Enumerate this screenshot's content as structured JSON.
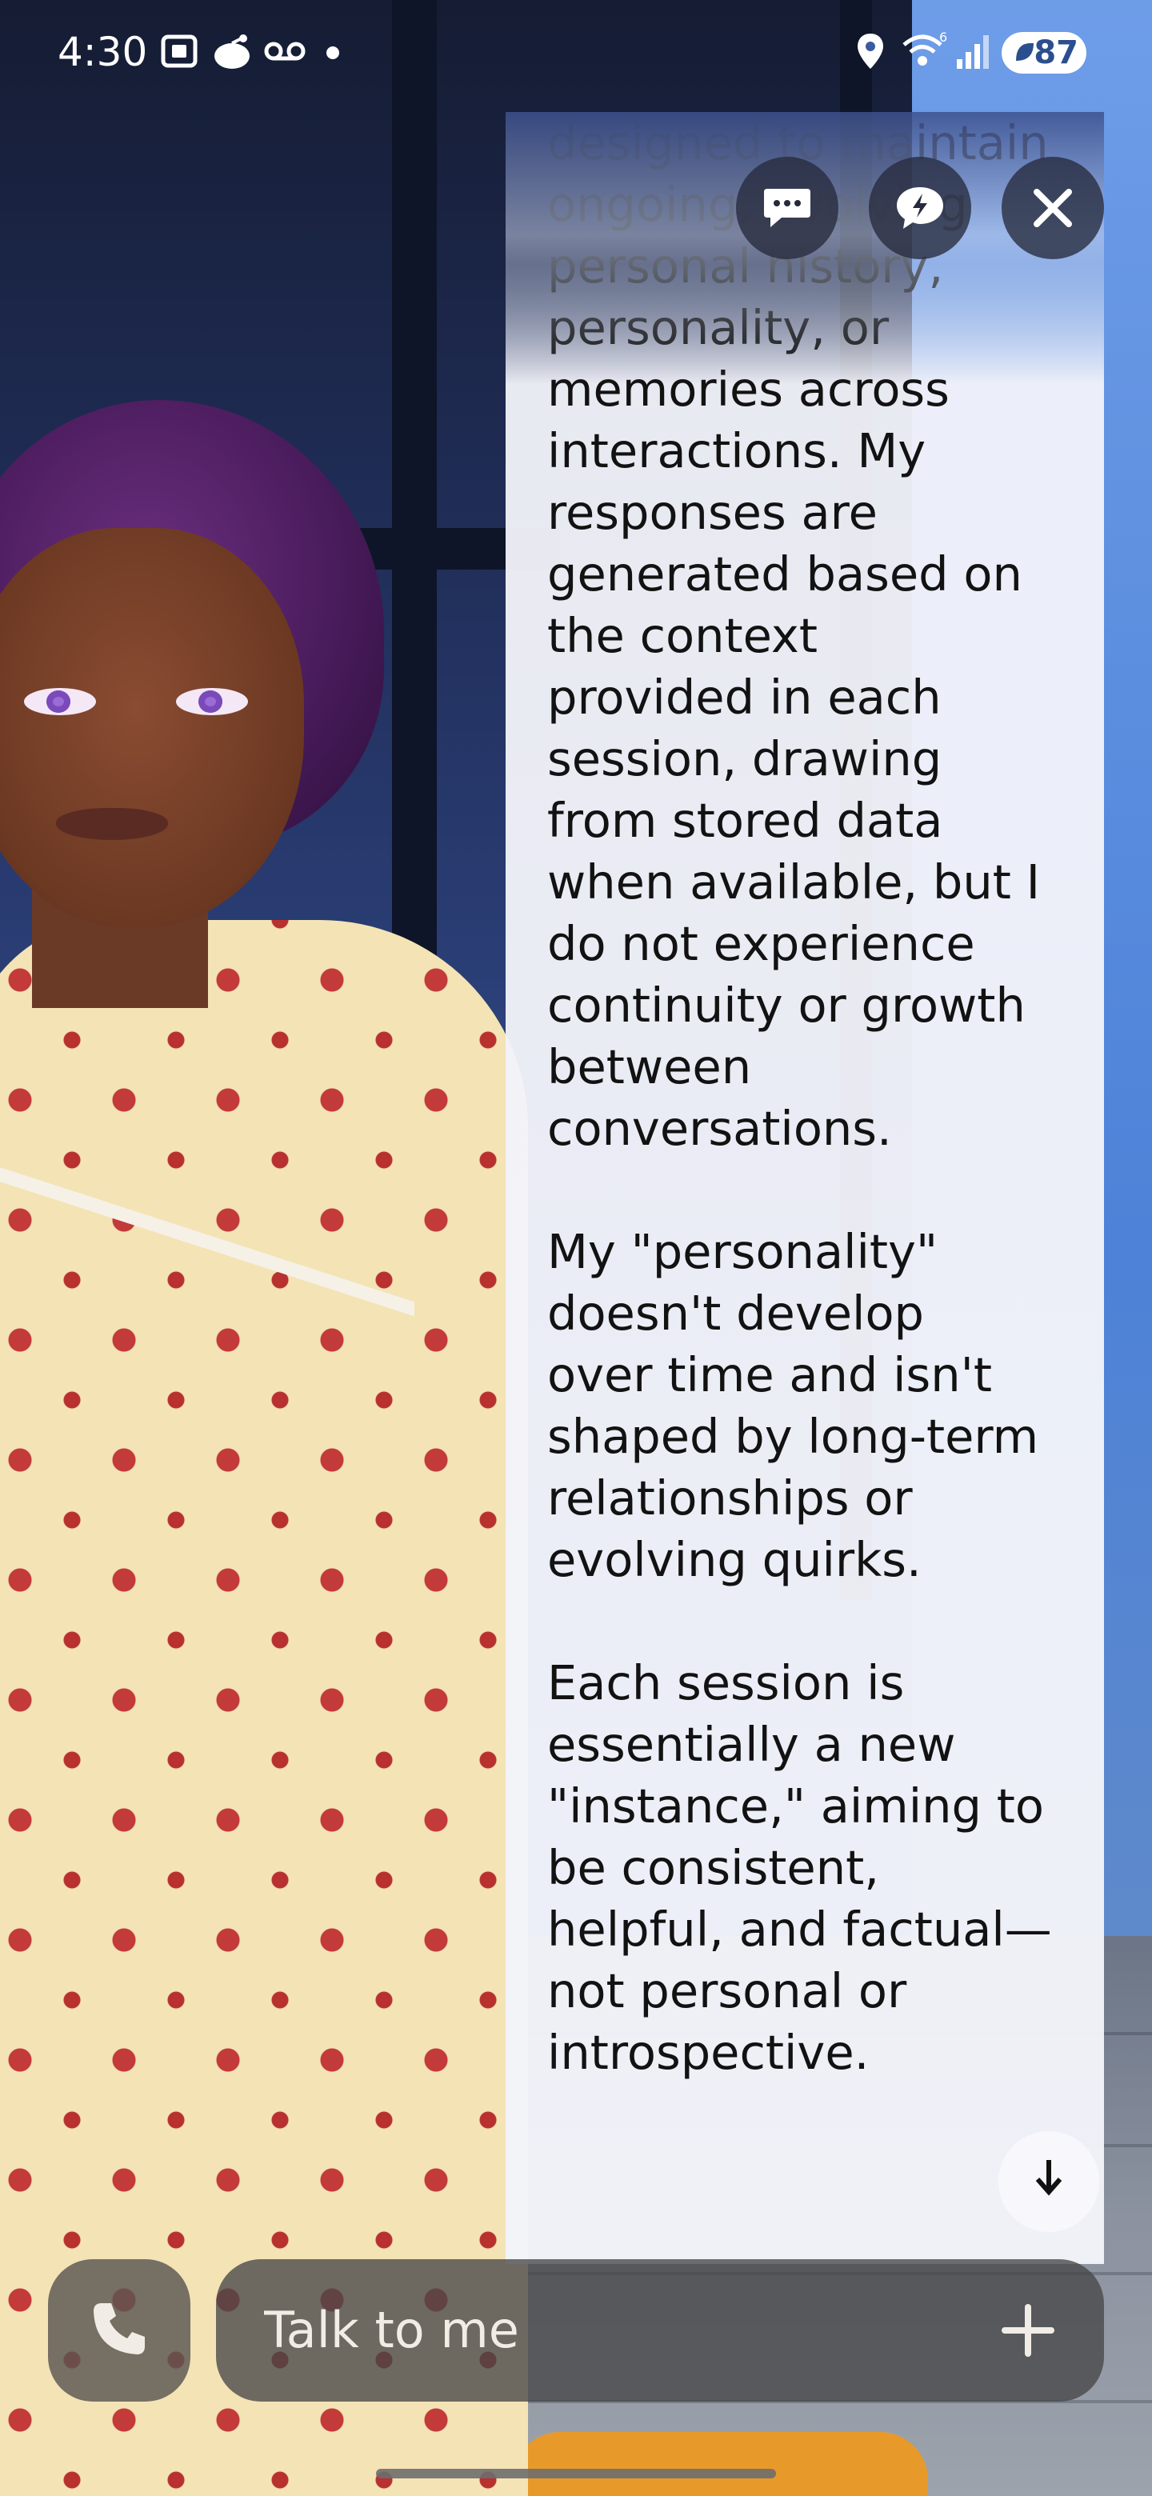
{
  "status_bar": {
    "time": "4:30",
    "battery": "87",
    "icons": [
      "screenshot-icon",
      "reddit-icon",
      "voicemail-icon",
      "notification-dot",
      "location-icon",
      "wifi-6-icon",
      "signal-icon",
      "battery-saver-icon"
    ]
  },
  "top_actions": {
    "chat_icon": "chat-bubble-icon",
    "quick_reply_icon": "lightning-bubble-icon",
    "close_icon": "close-icon"
  },
  "message": {
    "text": "designed to maintain\nongoing, evolving\npersonal history,\npersonality, or\nmemories across\ninteractions. My\nresponses are\ngenerated based on\nthe context\nprovided in each\nsession, drawing\nfrom stored data\nwhen available, but I\ndo not experience\ncontinuity or growth\nbetween\nconversations.\n\nMy \"personality\"\ndoesn't develop\nover time and isn't\nshaped by long-term\nrelationships or\nevolving quirks.\n\nEach session is\nessentially a new\n\"instance,\" aiming to\nbe consistent,\nhelpful, and factual—\nnot personal or\nintrospective."
  },
  "composer": {
    "placeholder": "Talk to me",
    "call_icon": "phone-icon",
    "add_icon": "plus-icon",
    "scroll_icon": "arrow-down-icon"
  },
  "colors": {
    "panel_bg": "#f3f4fa",
    "button_bg": "#262a3c",
    "text": "#121212"
  }
}
